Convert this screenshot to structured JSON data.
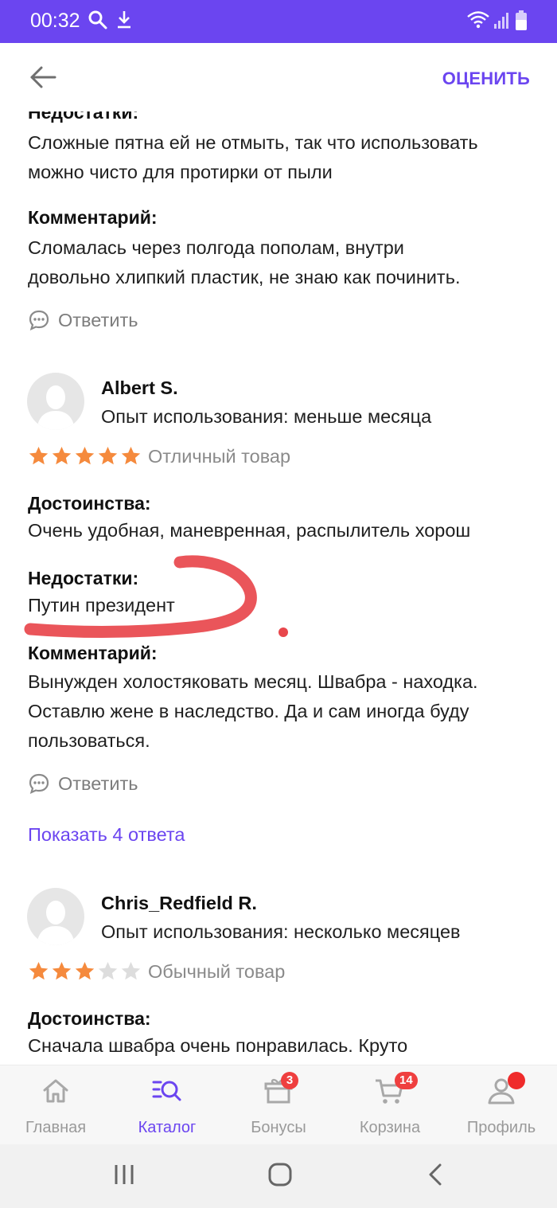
{
  "status_bar": {
    "time": "00:32"
  },
  "header": {
    "rate_label": "ОЦЕНИТЬ"
  },
  "review1": {
    "cons_label": "Недостатки:",
    "cons_lines": [
      "Сложные пятна ей не отмыть, так что использовать",
      "можно чисто для протирки от пыли"
    ],
    "comment_label": "Комментарий:",
    "comment_lines": [
      "Сломалась через полгода пополам, внутри",
      "довольно хлипкий пластик, не знаю как починить."
    ],
    "reply_label": "Ответить"
  },
  "review2": {
    "author": "Albert S.",
    "experience": "Опыт использования: меньше месяца",
    "stars": 5,
    "rating_label": "Отличный товар",
    "pros_label": "Достоинства:",
    "pros_text": "Очень удобная, маневренная, распылитель хорош",
    "cons_label": "Недостатки:",
    "cons_text": "Путин президент",
    "comment_label": "Комментарий:",
    "comment_lines": [
      "Вынужден холостяковать месяц. Швабра - находка.",
      "Оставлю жене в наследство. Да и сам иногда буду",
      "пользоваться."
    ],
    "reply_label": "Ответить",
    "show_answers": "Показать 4 ответа"
  },
  "review3": {
    "author": "Chris_Redfield R.",
    "experience": "Опыт использования: несколько месяцев",
    "stars": 3,
    "rating_label": "Обычный товар",
    "pros_label": "Достоинства:",
    "pros_text": "Сначала швабра очень понравилась. Круто"
  },
  "tabs": [
    {
      "label": "Главная",
      "icon": "home-icon"
    },
    {
      "label": "Каталог",
      "icon": "catalog-search-icon",
      "active": true
    },
    {
      "label": "Бонусы",
      "icon": "gift-icon",
      "badge": "3"
    },
    {
      "label": "Корзина",
      "icon": "cart-icon",
      "badge": "14"
    },
    {
      "label": "Профиль",
      "icon": "profile-icon"
    }
  ],
  "colors": {
    "accent": "#6b45f0",
    "star": "#f58a3d",
    "star_empty": "#dddddd",
    "badge": "#ef3f3f",
    "scribble": "#e8474c"
  }
}
